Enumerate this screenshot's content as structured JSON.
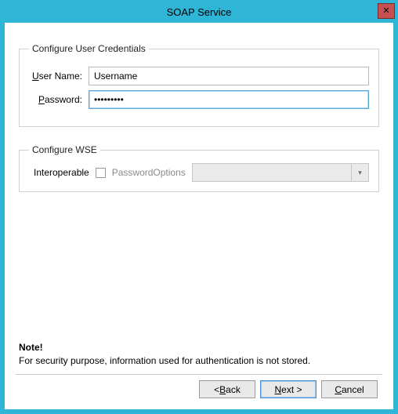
{
  "window": {
    "title": "SOAP Service"
  },
  "credentials": {
    "legend": "Configure User Credentials",
    "usernameLabel": "User Name:",
    "usernameValue": "Username",
    "passwordLabel": "Password:",
    "passwordValueMasked": "•••••••••"
  },
  "wse": {
    "legend": "Configure WSE",
    "interoperableLabel": "Interoperable",
    "interoperableChecked": false,
    "passwordOptionsLabel": "PasswordOptions",
    "passwordOptionsSelected": "",
    "passwordOptionsEnabled": false
  },
  "note": {
    "heading": "Note!",
    "text": "For security purpose, information used for authentication is not stored."
  },
  "buttons": {
    "backPrefix": "< ",
    "backU": "B",
    "backRest": "ack",
    "nextU": "N",
    "nextRest": "ext >",
    "cancelU": "C",
    "cancelRest": "ancel"
  }
}
